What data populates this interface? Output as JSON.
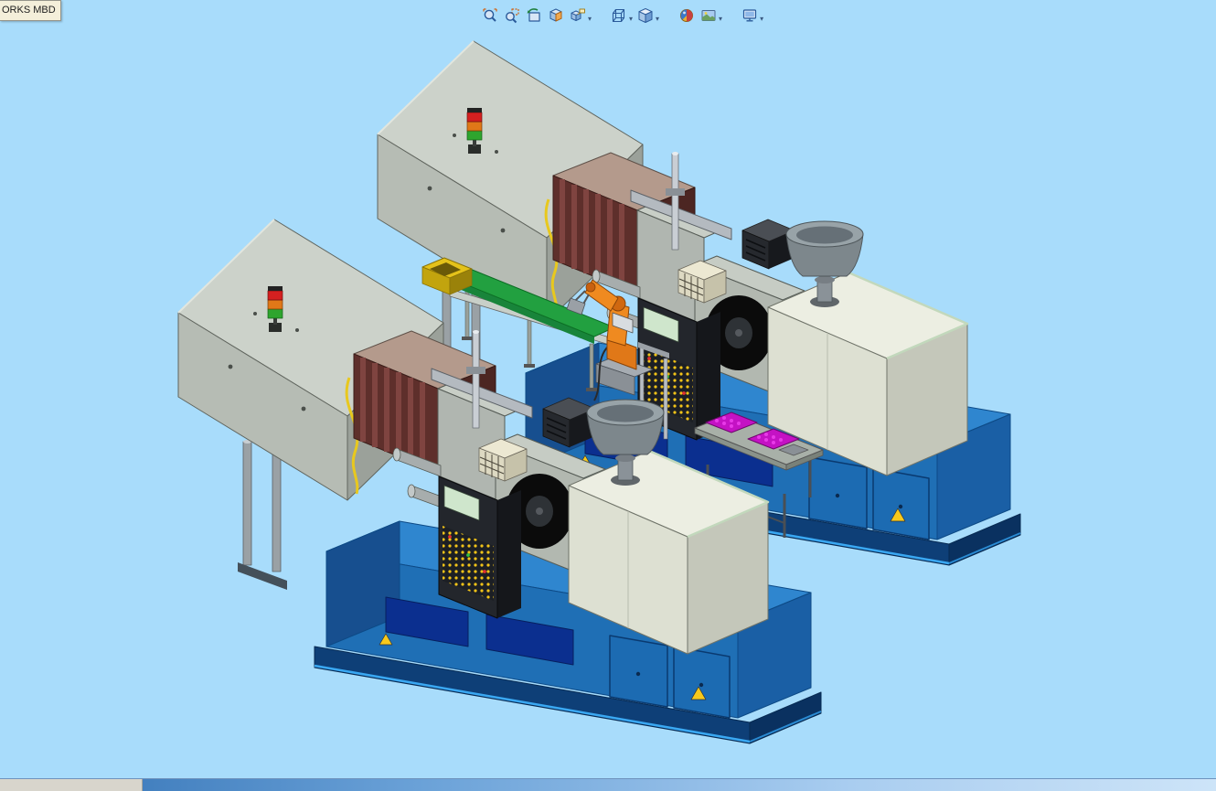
{
  "window": {
    "background": "#a8dcfb",
    "tooltip_label": "ORKS MBD"
  },
  "toolbar": {
    "name": "heads-up-view-toolbar",
    "items": [
      {
        "id": "zoom-to-fit",
        "label": "Zoom to Fit",
        "has_dropdown": false
      },
      {
        "id": "zoom-to-area",
        "label": "Zoom to Area",
        "has_dropdown": false
      },
      {
        "id": "previous-view",
        "label": "Previous View",
        "has_dropdown": false
      },
      {
        "id": "section-view",
        "label": "Section View",
        "has_dropdown": false
      },
      {
        "id": "dynamic-annotation-views",
        "label": "Dynamic Annotation Views",
        "has_dropdown": true
      },
      {
        "id": "view-orientation",
        "label": "View Orientation",
        "has_dropdown": true
      },
      {
        "id": "display-style",
        "label": "Display Style",
        "has_dropdown": true
      },
      {
        "id": "edit-appearance",
        "label": "Edit Appearance",
        "has_dropdown": false
      },
      {
        "id": "apply-scene",
        "label": "Apply Scene",
        "has_dropdown": true
      },
      {
        "id": "view-settings",
        "label": "View Settings",
        "has_dropdown": true
      }
    ]
  },
  "viewport": {
    "description": "Shaded 3D assembly: two blue injection molding machines arranged diagonally with central orange robot, green conveyor, yellow chute and magenta parts trays on a table",
    "machine_count": 2,
    "machine_colors": {
      "base": "#1f6fb5",
      "base_top": "#2f86cf",
      "base_panel": "#0b2f8f",
      "cover_top": "#ccd2ca",
      "cover_front": "#b6bcb4",
      "clamp_ribs": "#5e2f2b",
      "platen": "#b0b6b0",
      "housing_front": "#dde0d2",
      "hopper": "#98a3a8",
      "console": "#23262c",
      "console_keys": "#f2c318",
      "tower_red": "#d42020",
      "tower_amber": "#e07818",
      "tower_green": "#2ea52e",
      "conveyor_belt": "#22a040",
      "chute": "#e4c21a",
      "robot": "#e07818",
      "parts_trays": "#c412c4",
      "warning_sticker": "#f7c91c"
    }
  },
  "statusbar": {
    "left_segment_color": "#d8d5cc"
  }
}
